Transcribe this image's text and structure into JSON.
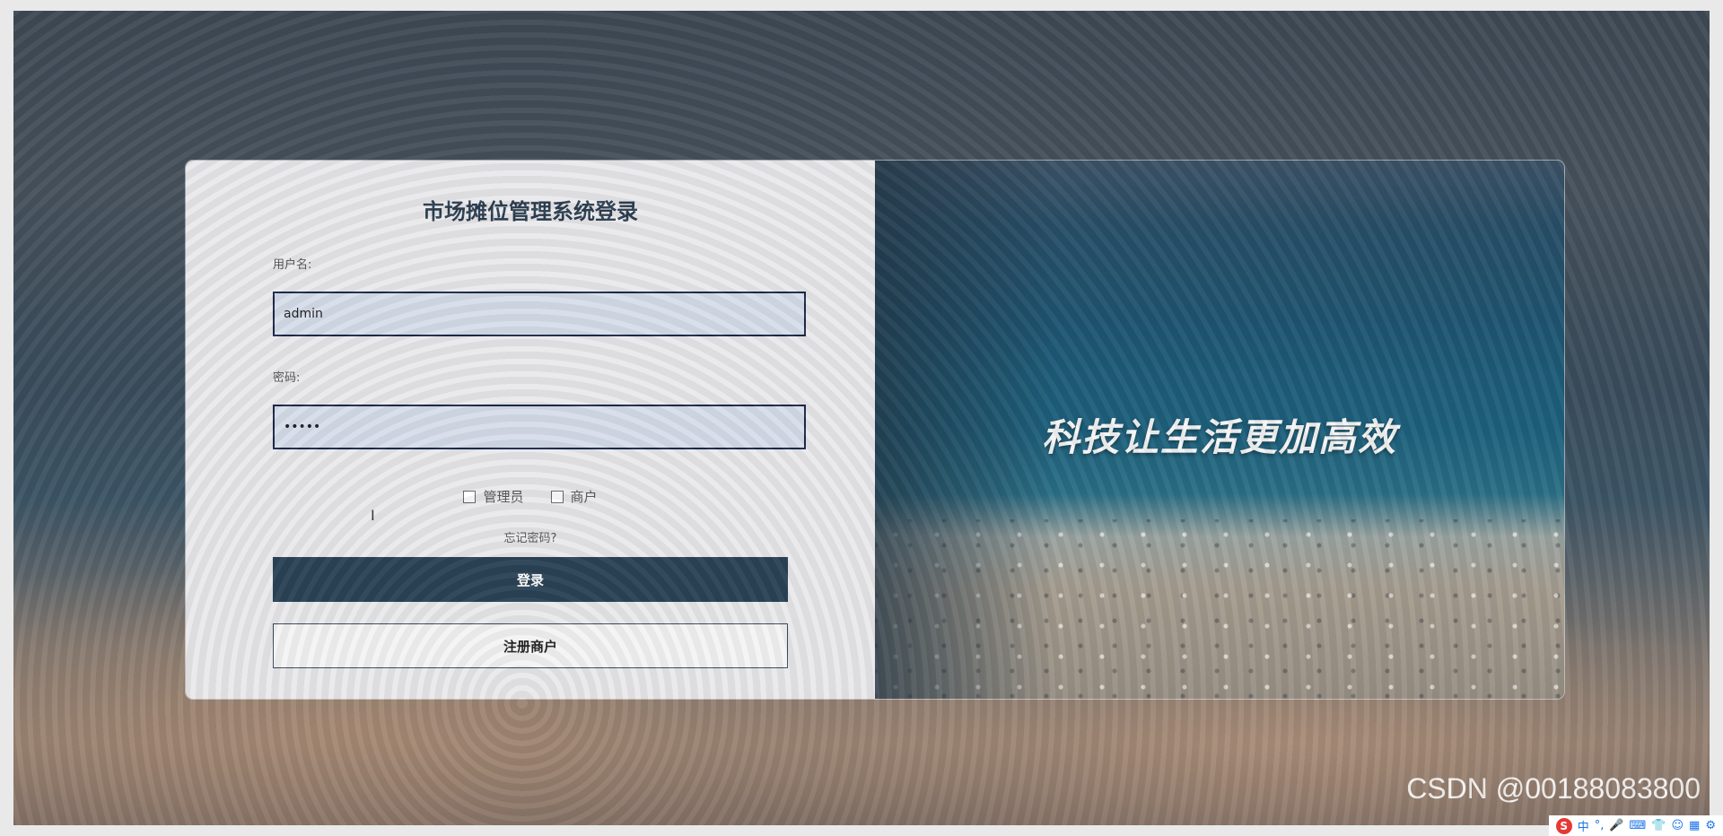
{
  "login": {
    "title": "市场摊位管理系统登录",
    "username_label": "用户名:",
    "username_value": "admin",
    "password_label": "密码:",
    "password_value": "•••••",
    "roles": [
      {
        "label": "管理员",
        "checked": false
      },
      {
        "label": "商户",
        "checked": false
      }
    ],
    "forgot_password": "忘记密码?",
    "login_button": "登录",
    "register_button": "注册商户"
  },
  "banner": {
    "slogan": "科技让生活更加高效"
  },
  "watermark": "CSDN @00188083800",
  "ime": {
    "logo": "S",
    "mode": "中"
  }
}
